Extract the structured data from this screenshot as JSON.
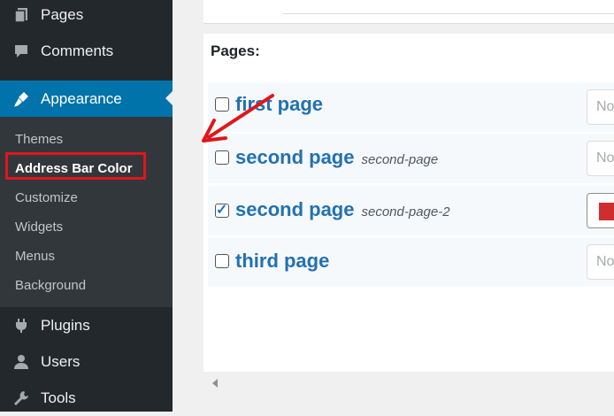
{
  "sidebar": {
    "pages": "Pages",
    "comments": "Comments",
    "appearance": "Appearance",
    "submenu": [
      "Themes",
      "Address Bar Color",
      "Customize",
      "Widgets",
      "Menus",
      "Background"
    ],
    "plugins": "Plugins",
    "users": "Users",
    "tools": "Tools"
  },
  "main": {
    "pages_title": "Pages:",
    "rows": [
      {
        "title": "first page",
        "slug": "",
        "checked": false,
        "field": "No"
      },
      {
        "title": "second page",
        "slug": "second-page",
        "checked": false,
        "field": "No"
      },
      {
        "title": "second page",
        "slug": "second-page-2",
        "checked": true,
        "field": ""
      },
      {
        "title": "third page",
        "slug": "",
        "checked": false,
        "field": "No"
      }
    ]
  },
  "colors": {
    "sidebar_bg": "#23282d",
    "submenu_bg": "#32373c",
    "active_blue": "#0073aa",
    "link_blue": "#2271b1",
    "highlight_red": "#e0161b",
    "swatch_red": "#cf2e2e"
  },
  "icons": [
    "pages-icon",
    "comments-icon",
    "appearance-icon",
    "plugins-icon",
    "users-icon",
    "tools-icon"
  ]
}
